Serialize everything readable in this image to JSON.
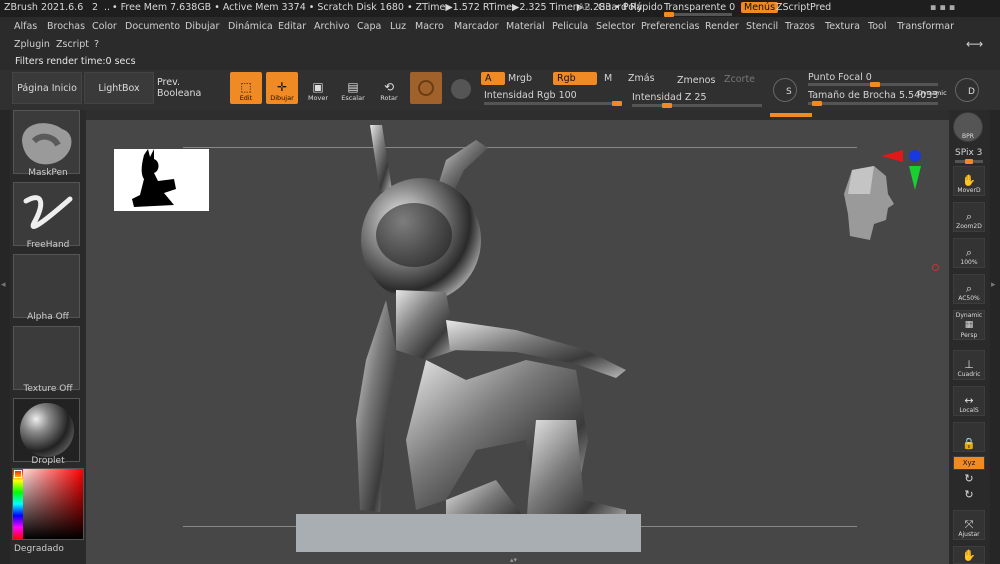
{
  "titlebar": {
    "app": "ZBrush 2021.6.6",
    "num": "2",
    "dots": "..",
    "stats": "• Free Mem 7.638GB • Active Mem 3374 • Scratch Disk 1680 • ZTime▶1.572 RTime▶2.325 Timer▶2.283 • Poly",
    "ar": "AR",
    "guard": "Guard Rápido",
    "transparent": "Transparente 0",
    "menus": "Menús",
    "zscript_pred": "ZScriptPred"
  },
  "menu": {
    "items": [
      "Alfas",
      "Brochas",
      "Color",
      "Documento",
      "Dibujar",
      "Dinámica",
      "Editar",
      "Archivo",
      "Capa",
      "Luz",
      "Macro",
      "Marcador",
      "Material",
      "Pelicula",
      "Selector",
      "Preferencias",
      "Render",
      "Stencil",
      "Trazos",
      "Textura",
      "Tool",
      "Transformar"
    ],
    "row2": [
      "Zplugin",
      "Zscript",
      "?"
    ]
  },
  "status": {
    "text": "Filters render time:0 secs"
  },
  "shelf": {
    "home": "Página Inicio",
    "lightbox": "LightBox",
    "boolean": "Prev. Booleana",
    "tools": [
      {
        "label": "Edit",
        "icon": "edit-icon",
        "active": true
      },
      {
        "label": "Dibujar",
        "icon": "draw-icon",
        "active": true
      },
      {
        "label": "Mover",
        "icon": "move-icon",
        "active": false
      },
      {
        "label": "Escalar",
        "icon": "scale-icon",
        "active": false
      },
      {
        "label": "Rotar",
        "icon": "rotate-icon",
        "active": false
      }
    ],
    "a_label": "A",
    "mrgb": "Mrgb",
    "rgb": "Rgb",
    "m": "M",
    "zmas": "Zmás",
    "zmenos": "Zmenos",
    "zcorte": "Zcorte",
    "rgb_intensity": "Intensidad Rgb 100",
    "rgb_intensity_value": 100,
    "z_intensity": "Intensidad Z 25",
    "z_intensity_value": 25,
    "focal": "Punto Focal 0",
    "brush_size": "Tamaño de Brocha 5.54033",
    "dynamic": "Dynamic",
    "s_label": "S",
    "d_label": "D"
  },
  "left": {
    "items": [
      "MaskPen",
      "FreeHand",
      "Alpha Off",
      "Texture Off",
      "Droplet"
    ],
    "gradient": "Degradado"
  },
  "right": {
    "items": [
      "BPR",
      "SPix 3",
      "MoverD",
      "Zoom2D",
      "100%",
      "AC50%",
      "Dynamic",
      "Persp",
      "Cuadric",
      "LocalS",
      "",
      "Xyz",
      "",
      "",
      "Ajustar"
    ]
  },
  "colors": {
    "accent": "#f08a24",
    "bg": "#2a2a2a",
    "canvas": "#474747"
  }
}
